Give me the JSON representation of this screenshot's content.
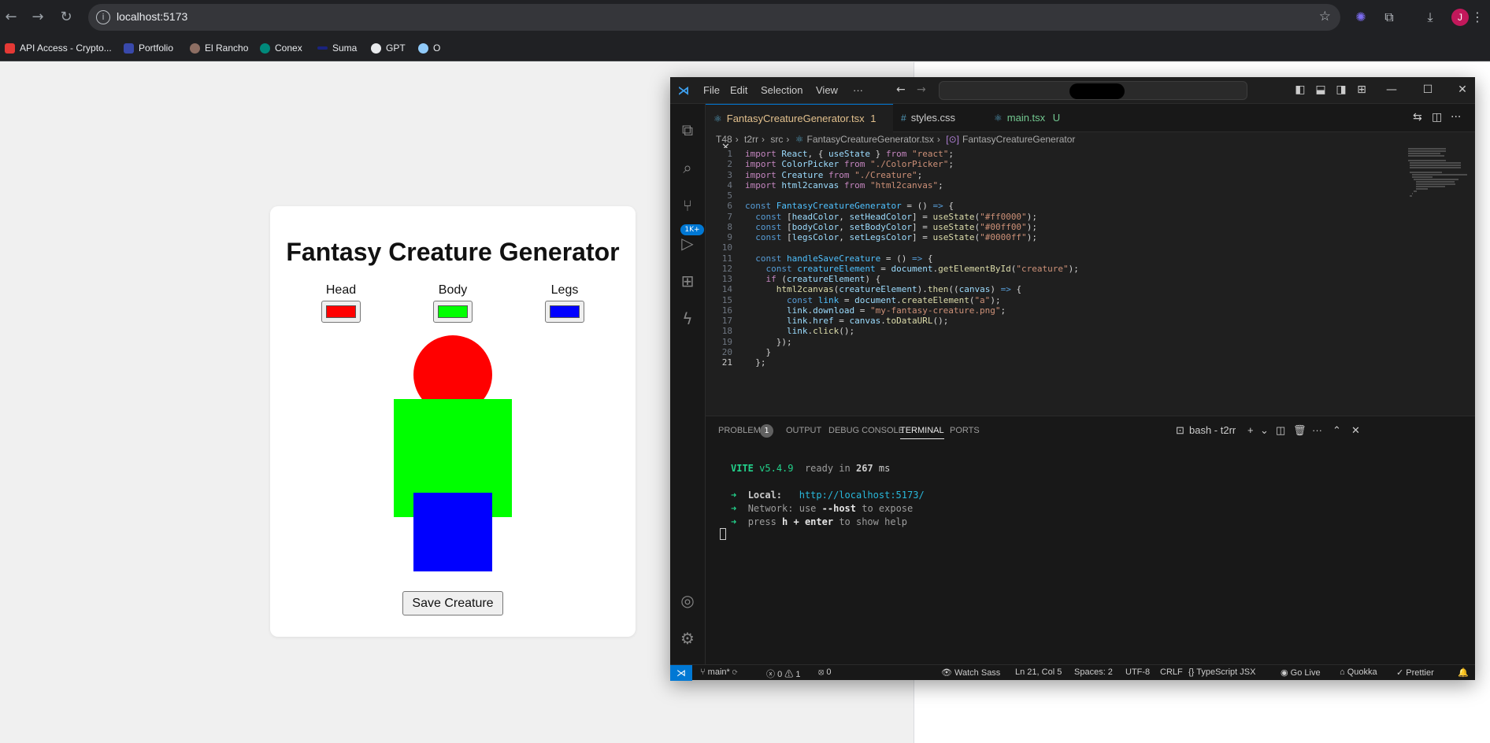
{
  "browser": {
    "url": "localhost:5173",
    "bookmarks": [
      "API Access - Crypto...",
      "Portfolio",
      "El Rancho",
      "Conex",
      "Suma",
      "GPT",
      "O"
    ],
    "profile_initial": "J"
  },
  "app": {
    "title": "Fantasy Creature Generator",
    "pickers": [
      {
        "label": "Head",
        "color": "#ff0000"
      },
      {
        "label": "Body",
        "color": "#00ff00"
      },
      {
        "label": "Legs",
        "color": "#0000ff"
      }
    ],
    "save_label": "Save Creature"
  },
  "vscode": {
    "menu": [
      "File",
      "Edit",
      "Selection",
      "View",
      "···"
    ],
    "tabs": [
      {
        "label": "FantasyCreatureGenerator.tsx",
        "badge": "1",
        "color": "#e2c08d"
      },
      {
        "label": "styles.css",
        "badge": "",
        "color": "#cccccc"
      },
      {
        "label": "main.tsx",
        "badge": "U",
        "color": "#73c991"
      }
    ],
    "breadcrumb": [
      "T48",
      "t2rr",
      "src",
      "FantasyCreatureGenerator.tsx",
      "FantasyCreatureGenerator"
    ],
    "activity_badge": "1K+",
    "code": [
      "import React, { useState } from \"react\";",
      "import ColorPicker from \"./ColorPicker\";",
      "import Creature from \"./Creature\";",
      "import html2canvas from \"html2canvas\";",
      "",
      "const FantasyCreatureGenerator = () => {",
      "  const [headColor, setHeadColor] = useState(\"#ff0000\");",
      "  const [bodyColor, setBodyColor] = useState(\"#00ff00\");",
      "  const [legsColor, setLegsColor] = useState(\"#0000ff\");",
      "",
      "  const handleSaveCreature = () => {",
      "    const creatureElement = document.getElementById(\"creature\");",
      "    if (creatureElement) {",
      "      html2canvas(creatureElement).then((canvas) => {",
      "        const link = document.createElement(\"a\");",
      "        link.download = \"my-fantasy-creature.png\";",
      "        link.href = canvas.toDataURL();",
      "        link.click();",
      "      });",
      "    }",
      "  };"
    ],
    "panel_tabs": [
      "PROBLEMS",
      "OUTPUT",
      "DEBUG CONSOLE",
      "TERMINAL",
      "PORTS"
    ],
    "problems_count": "1",
    "terminal_name": "bash - t2rr",
    "terminal": {
      "vite": "VITE",
      "version": "v5.4.9",
      "ready": "ready in",
      "ms_value": "267",
      "ms_unit": "ms",
      "local_label": "Local:",
      "local_url": "http://localhost:5173/",
      "network_label": "Network:",
      "network_text_a": "use",
      "network_flag": "--host",
      "network_text_b": "to expose",
      "help_a": "press",
      "help_key": "h + enter",
      "help_b": "to show help"
    },
    "status": {
      "branch": "main*",
      "errors": "0",
      "warnings": "1",
      "ports": "0",
      "watch_sass": "Watch Sass",
      "position": "Ln 21, Col 5",
      "spaces": "Spaces: 2",
      "encoding": "UTF-8",
      "eol": "CRLF",
      "language": "TypeScript JSX",
      "go_live": "Go Live",
      "quokka": "Quokka",
      "prettier": "Prettier"
    }
  }
}
